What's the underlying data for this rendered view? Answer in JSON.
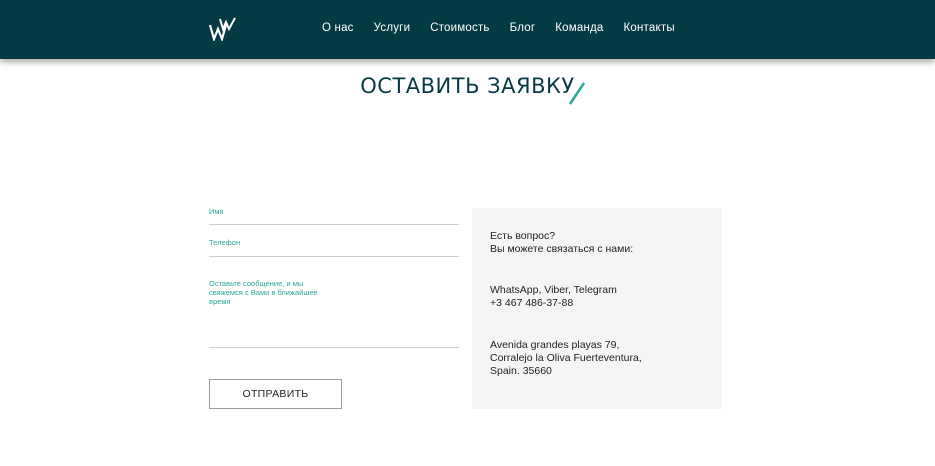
{
  "nav": {
    "items": [
      "О нас",
      "Услуги",
      "Стоимость",
      "Блог",
      "Команда",
      "Контакты"
    ]
  },
  "page": {
    "title": "ОСТАВИТЬ ЗАЯВКУ"
  },
  "form": {
    "name_label": "Имя",
    "phone_label": "Телефон",
    "message_label": "Оставьте сообщение, и мы свяжемся с Вами в ближайшее время",
    "submit_label": "ОТПРАВИТЬ"
  },
  "contacts": {
    "question_line1": "Есть вопрос?",
    "question_line2": "Вы можете связаться с нами:",
    "messengers": "WhatsApp, Viber, Telegram",
    "phone": "+3 467 486-37-88",
    "address_line1": "Avenida grandes playas 79,",
    "address_line2": "Corralejo la Oliva Fuerteventura,",
    "address_line3": "Spain. 35660"
  },
  "colors": {
    "header_bg": "#033a44",
    "accent": "#2aa89a",
    "title": "#073a44"
  },
  "icons": {
    "logo": "ww-logo-icon",
    "title_accent": "slash-accent-icon"
  }
}
